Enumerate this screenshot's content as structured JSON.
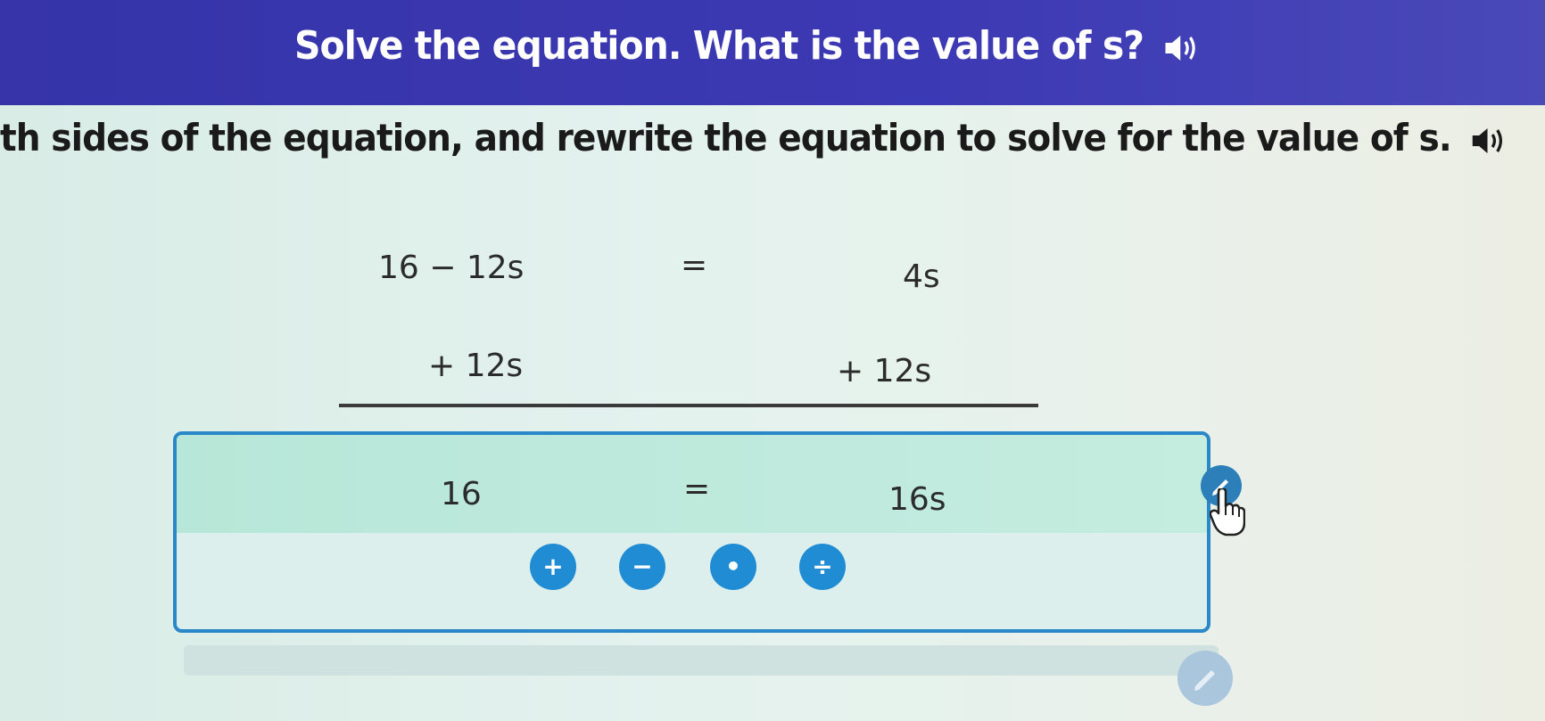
{
  "header": {
    "title": "Solve the equation. What is the value of s?",
    "speaker_icon": "speaker-icon",
    "background": "#3836ad"
  },
  "instruction": {
    "text": "th sides of the equation, and rewrite the equation to solve for the value of s.",
    "speaker_icon": "speaker-icon"
  },
  "equation": {
    "left": "16 − 12s",
    "equals": "=",
    "right": "4s",
    "left_add": "+ 12s",
    "right_add": "+ 12s"
  },
  "result": {
    "left": "16",
    "equals": "=",
    "right": "16s"
  },
  "operations": [
    {
      "label": "+",
      "name": "add-button"
    },
    {
      "label": "−",
      "name": "subtract-button"
    },
    {
      "label": "•",
      "name": "multiply-button"
    },
    {
      "label": "÷",
      "name": "divide-button"
    }
  ],
  "colors": {
    "accent_blue": "#1f8cd4",
    "box_border": "#2a88c8",
    "result_fill": "#bde9dc"
  }
}
